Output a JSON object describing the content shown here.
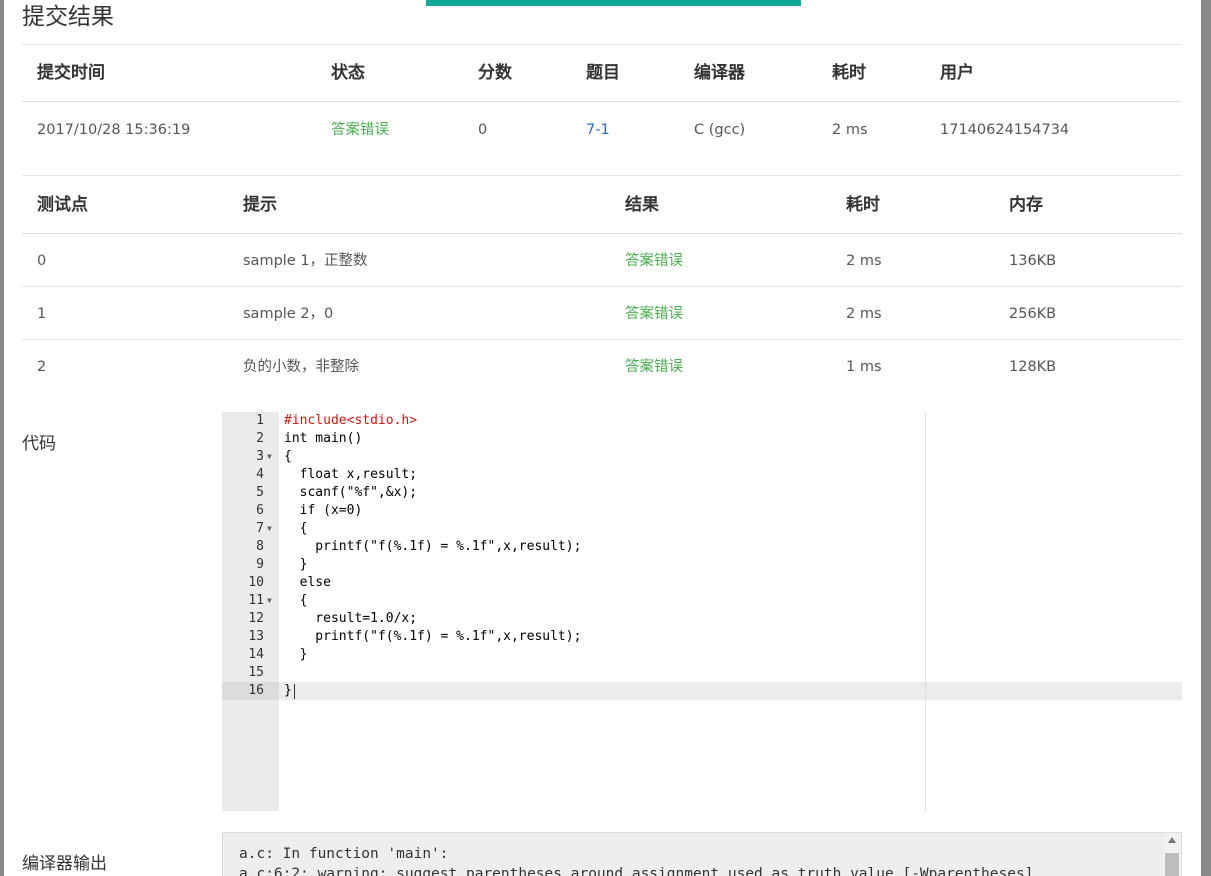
{
  "modal": {
    "title": "提交结果"
  },
  "summary": {
    "headers": [
      "提交时间",
      "状态",
      "分数",
      "题目",
      "编译器",
      "耗时",
      "用户"
    ],
    "row": {
      "submit_time": "2017/10/28 15:36:19",
      "status": "答案错误",
      "score": "0",
      "problem": "7-1",
      "compiler": "C (gcc)",
      "time": "2 ms",
      "user": "17140624154734"
    }
  },
  "testcases": {
    "headers": [
      "测试点",
      "提示",
      "结果",
      "耗时",
      "内存"
    ],
    "rows": [
      {
        "id": "0",
        "hint": "sample 1，正整数",
        "result": "答案错误",
        "time": "2 ms",
        "memory": "136KB"
      },
      {
        "id": "1",
        "hint": "sample 2，0",
        "result": "答案错误",
        "time": "2 ms",
        "memory": "256KB"
      },
      {
        "id": "2",
        "hint": "负的小数，非整除",
        "result": "答案错误",
        "time": "1 ms",
        "memory": "128KB"
      }
    ]
  },
  "code": {
    "label": "代码",
    "line_numbers": [
      "1",
      "2",
      "3",
      "4",
      "5",
      "6",
      "7",
      "8",
      "9",
      "10",
      "11",
      "12",
      "13",
      "14",
      "15",
      "16"
    ],
    "lines": [
      "#include<stdio.h>",
      "int main()",
      "{",
      "  float x,result;",
      "  scanf(\"%f\",&x);",
      "  if (x=0)",
      "  {",
      "    printf(\"f(%.1f) = %.1f\",x,result);",
      "  }",
      "  else",
      "  {",
      "    result=1.0/x;",
      "    printf(\"f(%.1f) = %.1f\",x,result);",
      "  }",
      "",
      "}"
    ]
  },
  "compiler_output": {
    "label": "编译器输出",
    "lines": [
      "a.c: In function 'main':",
      "a.c:6:2: warning: suggest parentheses around assignment used as truth value [-Wparentheses]"
    ]
  },
  "colors": {
    "accent": "#14a898",
    "status": "#4caf50",
    "link": "#2a6ebb"
  }
}
